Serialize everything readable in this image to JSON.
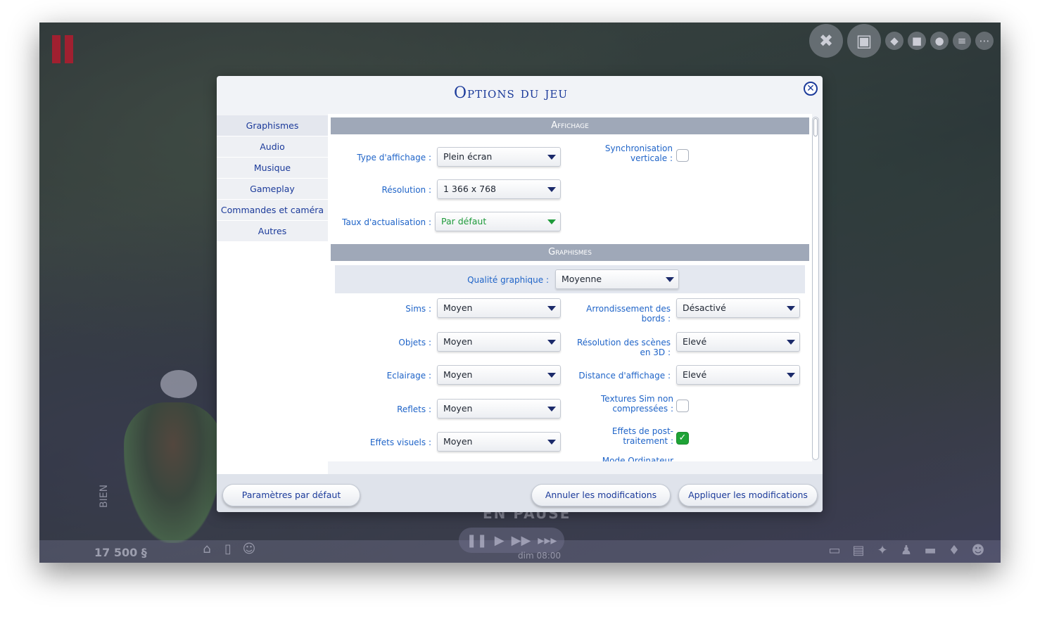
{
  "dialog": {
    "title": "Options du jeu",
    "close_symbol": "✕"
  },
  "sidebar": {
    "items": [
      {
        "label": "Graphismes"
      },
      {
        "label": "Audio"
      },
      {
        "label": "Musique"
      },
      {
        "label": "Gameplay"
      },
      {
        "label": "Commandes et caméra"
      },
      {
        "label": "Autres"
      }
    ]
  },
  "affichage": {
    "header": "Affichage",
    "type_label": "Type d'affichage :",
    "type_value": "Plein écran",
    "resolution_label": "Résolution :",
    "resolution_value": "1 366 x 768",
    "refresh_label": "Taux d'actualisation :",
    "refresh_value": "Par défaut",
    "vsync_label_1": "Synchronisation",
    "vsync_label_2": "verticale :",
    "vsync_checked": false
  },
  "graphismes": {
    "header": "Graphismes",
    "quality_label": "Qualité graphique :",
    "quality_value": "Moyenne",
    "sims_label": "Sims :",
    "sims_value": "Moyen",
    "objets_label": "Objets :",
    "objets_value": "Moyen",
    "eclairage_label": "Eclairage :",
    "eclairage_value": "Moyen",
    "reflets_label": "Reflets :",
    "reflets_value": "Moyen",
    "effets_label": "Effets visuels :",
    "effets_value": "Moyen",
    "arrondissement_label_1": "Arrondissement des",
    "arrondissement_label_2": "bords :",
    "arrondissement_value": "Désactivé",
    "resolution3d_label_1": "Résolution des scènes",
    "resolution3d_label_2": "en 3D :",
    "resolution3d_value": "Elevé",
    "distance_label": "Distance d'affichage :",
    "distance_value": "Elevé",
    "textures_label_1": "Textures Sim non",
    "textures_label_2": "compressées :",
    "textures_checked": false,
    "post_label_1": "Effets de post-",
    "post_label_2": "traitement :",
    "post_checked": true,
    "mode_label_partial": "Mode Ordinateur"
  },
  "footer": {
    "defaults_button": "Paramètres par défaut",
    "cancel_button": "Annuler les modifications",
    "apply_button": "Appliquer les modifications"
  },
  "background": {
    "funds": "17 500 §",
    "status_vertical": "BIEN",
    "pause_label": "EN PAUSE",
    "time": "dim 08:00"
  },
  "colors": {
    "title_blue": "#1b3a9a",
    "label_blue": "#1f64c8",
    "header_gray": "#9fa8b8",
    "green": "#1e9a3a",
    "pause_red": "#a02030"
  }
}
